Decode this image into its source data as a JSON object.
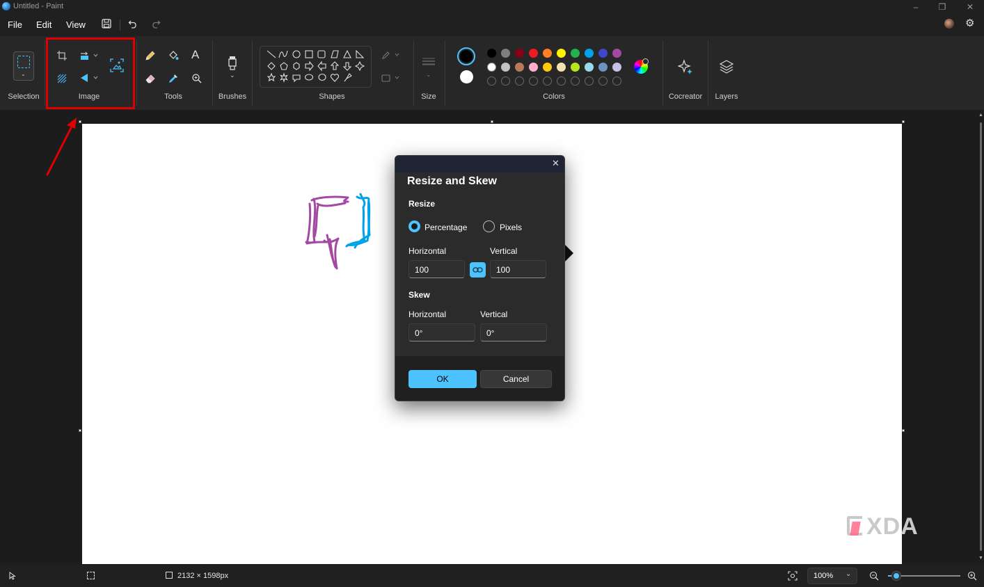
{
  "window": {
    "title": "Untitled - Paint"
  },
  "menu": {
    "file": "File",
    "edit": "Edit",
    "view": "View"
  },
  "ribbon": {
    "groups": {
      "selection": "Selection",
      "image": "Image",
      "tools": "Tools",
      "brushes": "Brushes",
      "shapes": "Shapes",
      "size": "Size",
      "colors": "Colors",
      "cocreator": "Cocreator",
      "layers": "Layers"
    },
    "colors": {
      "primary": "#000000",
      "secondary": "#ffffff",
      "palette_row1": [
        "#000000",
        "#7f7f7f",
        "#880015",
        "#ed1c24",
        "#ff7f27",
        "#fff200",
        "#22b14c",
        "#00a2e8",
        "#3f48cc",
        "#a349a4"
      ],
      "palette_row2": [
        "#ffffff",
        "#c3c3c3",
        "#b97a57",
        "#ffaec9",
        "#ffc90e",
        "#efe4b0",
        "#b5e61d",
        "#99d9ea",
        "#7092be",
        "#c8bfe7"
      ]
    }
  },
  "annotation": {
    "highlight_color": "#e00000"
  },
  "dialog": {
    "title": "Resize and Skew",
    "resize_heading": "Resize",
    "option_percentage": "Percentage",
    "option_pixels": "Pixels",
    "selected_option": "Percentage",
    "resize_horizontal_label": "Horizontal",
    "resize_vertical_label": "Vertical",
    "resize_horizontal_value": "100",
    "resize_vertical_value": "100",
    "skew_heading": "Skew",
    "skew_horizontal_label": "Horizontal",
    "skew_vertical_label": "Vertical",
    "skew_horizontal_value": "0°",
    "skew_vertical_value": "0°",
    "ok_label": "OK",
    "cancel_label": "Cancel",
    "accent": "#4cc2ff"
  },
  "statusbar": {
    "canvas_size": "2132 × 1598px",
    "zoom": "100%",
    "zoom_level": 0.12
  },
  "watermark": "XDA"
}
